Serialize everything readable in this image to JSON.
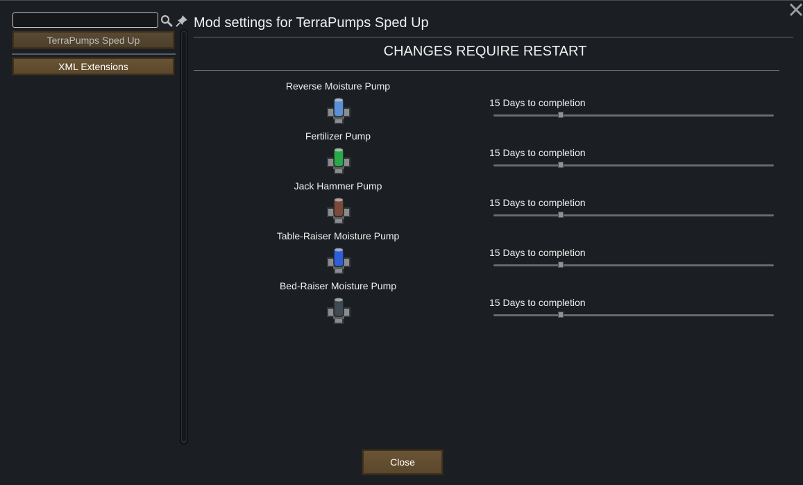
{
  "dialog": {
    "title": "Mod settings for TerraPumps Sped Up",
    "restart_notice": "CHANGES REQUIRE RESTART",
    "close_label": "Close"
  },
  "sidebar": {
    "search": {
      "value": "",
      "placeholder": ""
    },
    "mods": [
      {
        "label": "TerraPumps Sped Up",
        "selected": true
      },
      {
        "label": "XML Extensions",
        "selected": false
      }
    ]
  },
  "pumps": [
    {
      "name": "Reverse Moisture Pump",
      "days_label": "15 Days to completion",
      "slider_value_fraction": 0.24,
      "color": "#5b8fd6"
    },
    {
      "name": "Fertilizer Pump",
      "days_label": "15 Days to completion",
      "slider_value_fraction": 0.24,
      "color": "#2aa84a"
    },
    {
      "name": "Jack Hammer Pump",
      "days_label": "15 Days to completion",
      "slider_value_fraction": 0.24,
      "color": "#7a4a3a"
    },
    {
      "name": "Table-Raiser Moisture Pump",
      "days_label": "15 Days to completion",
      "slider_value_fraction": 0.24,
      "color": "#2f5fd8"
    },
    {
      "name": "Bed-Raiser Moisture Pump",
      "days_label": "15 Days to completion",
      "slider_value_fraction": 0.24,
      "color": "#3f4a52"
    }
  ],
  "colors": {
    "background": "#1b1e22",
    "button_brown": "#5a4629",
    "divider": "#6a6d71"
  },
  "icons": [
    "search-icon",
    "pin-icon",
    "close-icon",
    "pump-icon"
  ]
}
